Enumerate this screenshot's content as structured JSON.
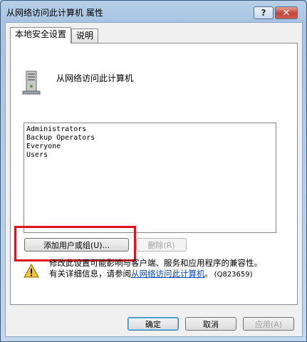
{
  "window": {
    "title": "从网络访问此计算机 属性",
    "help_label": "?",
    "close_label": "✕"
  },
  "tabs": [
    {
      "label": "本地安全设置",
      "selected": true
    },
    {
      "label": "说明",
      "selected": false
    }
  ],
  "policy": {
    "name": "从网络访问此计算机",
    "icon": "computer-icon"
  },
  "members": [
    "Administrators",
    "Backup Operators",
    "Everyone",
    "Users"
  ],
  "buttons": {
    "add": "添加用户或组(U)...",
    "remove": "删除(R)"
  },
  "warning": {
    "icon": "warning-icon",
    "line1": "修改此设置可能影响与客户端、服务和应用程序的兼容性。",
    "line2_prefix": "有关详细信息，请参阅",
    "link": "从网络访问此计算机",
    "line2_suffix": "。 (Q823659)"
  },
  "footer": {
    "ok": "确定",
    "cancel": "取消",
    "apply": "应用(A)"
  },
  "colors": {
    "highlight": "#e1121b",
    "link": "#0645c6"
  }
}
